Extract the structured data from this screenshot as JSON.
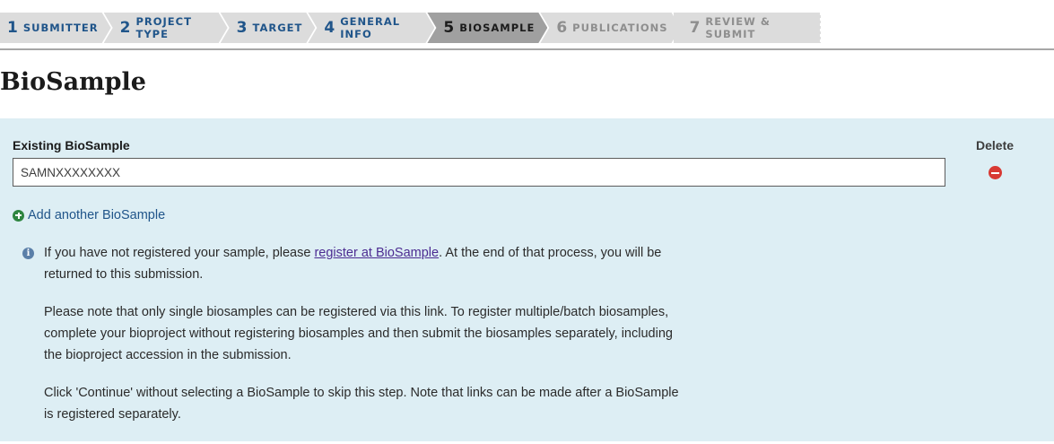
{
  "steps": [
    {
      "num": "1",
      "label": "Submitter",
      "state": "done"
    },
    {
      "num": "2",
      "label": "Project Type",
      "state": "done"
    },
    {
      "num": "3",
      "label": "Target",
      "state": "done"
    },
    {
      "num": "4",
      "label": "General Info",
      "state": "done"
    },
    {
      "num": "5",
      "label": "BioSample",
      "state": "active"
    },
    {
      "num": "6",
      "label": "Publications",
      "state": "disabled"
    },
    {
      "num": "7",
      "label": "Review & Submit",
      "state": "disabled"
    }
  ],
  "page_title": "BioSample",
  "biosample": {
    "field_label": "Existing BioSample",
    "value": "SAMNXXXXXXXX",
    "delete_label": "Delete",
    "add_link": "Add another BioSample"
  },
  "info": {
    "p1_before": "If you have not registered your sample, please ",
    "p1_link": "register at BioSample",
    "p1_after": ". At the end of that process, you will be returned to this submission.",
    "p2": "Please note that only single biosamples can be registered via this link. To register multiple/batch biosamples, complete your bioproject without registering biosamples and then submit the biosamples separately, including the bioproject accession in the submission.",
    "p3": "Click 'Continue' without selecting a BioSample to skip this step. Note that links can be made after a BioSample is registered separately."
  },
  "colors": {
    "panel": "#ddeef4",
    "step_link": "#20558a",
    "step_active": "#a0a0a0",
    "delete": "#d83933",
    "add": "#2e8540"
  },
  "icons": [
    "minus-circle-icon",
    "plus-circle-icon",
    "info-circle-icon"
  ]
}
